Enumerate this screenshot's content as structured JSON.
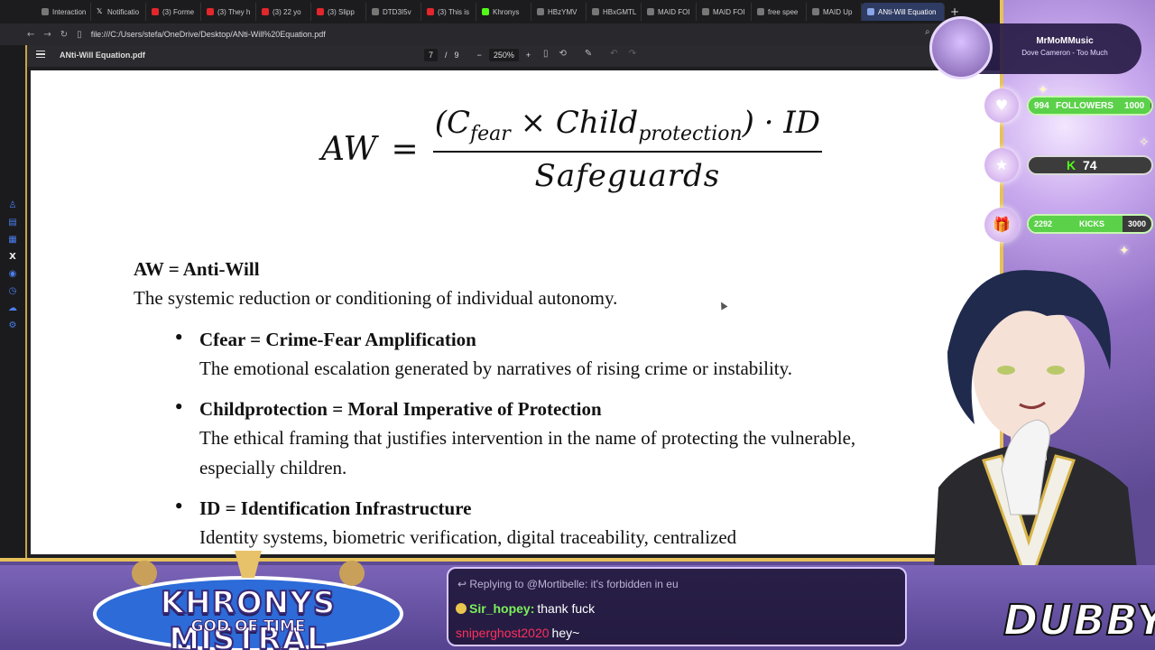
{
  "browser": {
    "tabs": [
      {
        "label": "Interaction",
        "icon": "gen"
      },
      {
        "label": "Notificatio",
        "icon": "x"
      },
      {
        "label": "(3) Forme",
        "icon": "yt"
      },
      {
        "label": "(3) They h",
        "icon": "yt"
      },
      {
        "label": "(3) 22 yo",
        "icon": "yt"
      },
      {
        "label": "(3) Slipp",
        "icon": "yt"
      },
      {
        "label": "DTD3I5v",
        "icon": "gen"
      },
      {
        "label": "(3) This is",
        "icon": "yt"
      },
      {
        "label": "Khronys",
        "icon": "k"
      },
      {
        "label": "HBzYMV",
        "icon": "gen"
      },
      {
        "label": "HBxGMTL",
        "icon": "gen"
      },
      {
        "label": "MAID FOI",
        "icon": "gen"
      },
      {
        "label": "MAID FOI",
        "icon": "gen"
      },
      {
        "label": "free spee",
        "icon": "gen"
      },
      {
        "label": "MAID Up",
        "icon": "gen"
      },
      {
        "label": "ANti-Will Equation",
        "icon": "doc",
        "active": true
      }
    ],
    "url": "file:///C:/Users/stefa/OneDrive/Desktop/ANti-Will%20Equation.pdf"
  },
  "pdf": {
    "title": "ANti-Will Equation.pdf",
    "page_current": "7",
    "page_total": "9",
    "zoom": "250%"
  },
  "equation": {
    "lhs": "AW",
    "equals": "=",
    "num_open": "(C",
    "num_sub1": "fear",
    "num_times": " × Child",
    "num_sub2": "protection",
    "num_close": ") · ID",
    "denominator": "Safeguards"
  },
  "definitions": {
    "aw_title": "AW = Anti-Will",
    "aw_text": "The systemic reduction or conditioning of individual autonomy.",
    "cfear_title": "Cfear = Crime-Fear Amplification",
    "cfear_text": "The emotional escalation generated by narratives of rising crime or instability.",
    "child_title": "Childprotection = Moral Imperative of Protection",
    "child_text1": "The ethical framing that justifies intervention in the name of protecting the vulnerable,",
    "child_text2": "especially children.",
    "id_title": "ID = Identification Infrastructure",
    "id_text": "Identity systems, biometric verification, digital traceability, centralized"
  },
  "stream": {
    "now_playing_title": "MrMoMMusic",
    "now_playing_artist": "Dove Cameron - Too Much",
    "followers_current": "994",
    "followers_label": "FOLLOWERS",
    "followers_goal": "1000",
    "followers_progress": 0.994,
    "kick_count": "74",
    "kicks_current": "2292",
    "kicks_label": "KICKS",
    "kicks_goal": "3000",
    "kicks_progress": 0.764,
    "logo_main": "KHRONYS MISTRAL",
    "logo_sub": "GOD OF TIME",
    "brand": "DUBBY"
  },
  "chat": {
    "reply": "Replying to @Mortibelle: it's forbidden in eu",
    "user1": "Sir_hopey:",
    "msg1": "thank fuck",
    "user2": "sniperghost2020",
    "msg2": "hey~"
  },
  "colors": {
    "accent_gold": "#e6c15a",
    "goal_green": "#5bd149",
    "chat_user_green": "#7cf05a",
    "chat_user_red": "#ff2f5c"
  }
}
